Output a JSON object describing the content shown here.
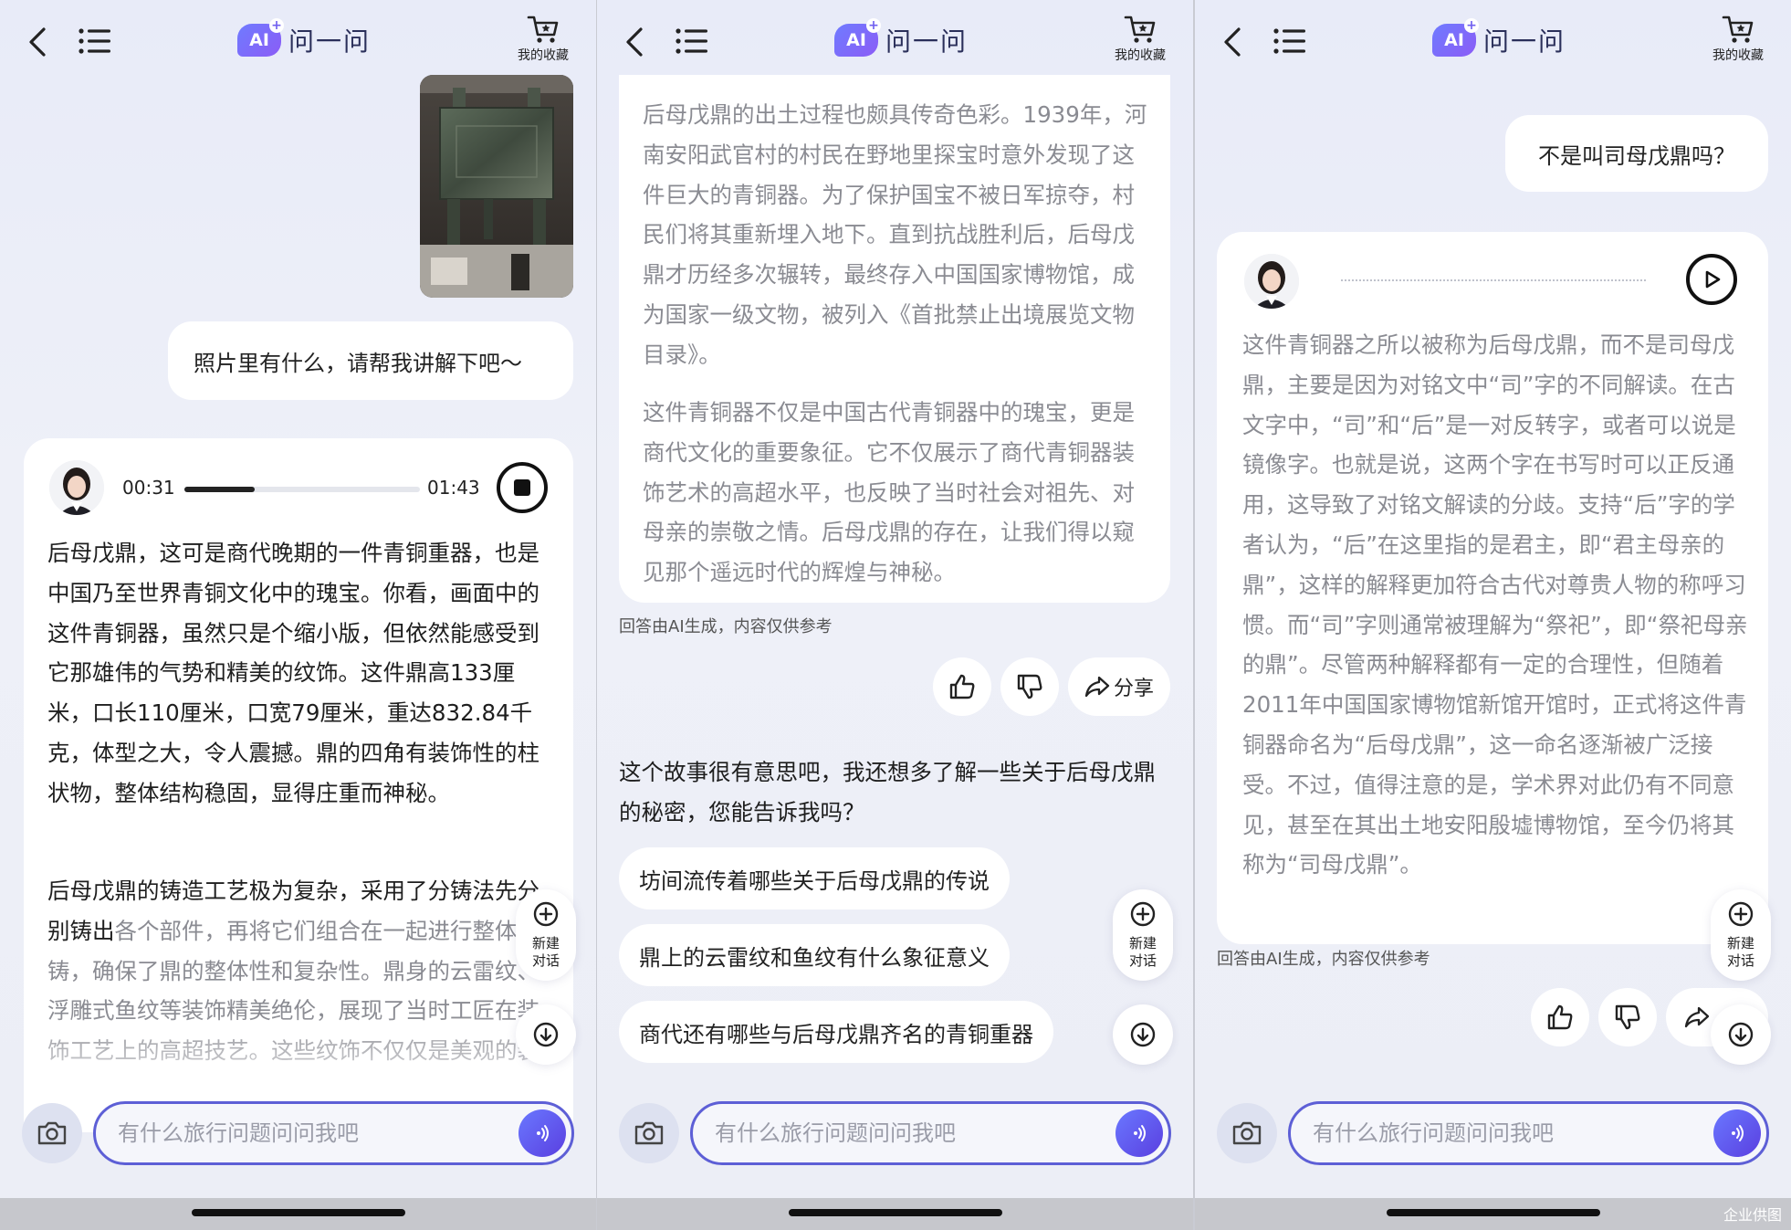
{
  "header": {
    "ai_badge": "AI",
    "title": "问一问",
    "favorites_label": "我的收藏"
  },
  "panel1": {
    "user_question": "照片里有什么，请帮我讲解下吧～",
    "audio": {
      "elapsed": "00:31",
      "total": "01:43",
      "progress": 0.3
    },
    "paragraphs": [
      "后母戊鼎，这可是商代晚期的一件青铜重器，也是中国乃至世界青铜文化中的瑰宝。你看，画面中的这件青铜器，虽然只是个缩小版，但依然能感受到它那雄伟的气势和精美的纹饰。这件鼎高133厘米，口长110厘米，口宽79厘米，重达832.84千克，体型之大，令人震撼。鼎的四角有装饰性的柱状物，整体结构稳固，显得庄重而神秘。",
      "后母戊鼎的铸造工艺极为复杂，采用了分铸法",
      "先分别铸出",
      "各个部件，再将它们组合在一起进行整体浇铸，确保了鼎的整体性和复杂性。鼎身的云雷纹、浮雕式鱼纹等装饰精美绝伦，展现了当时工匠在装饰工艺上的高超技艺。这些纹饰不仅仅是美观的装饰，还蕴含着深厚的文化意义。"
    ]
  },
  "panel2": {
    "paragraphs": [
      "后母戊鼎的出土过程也颇具传奇色彩。1939年，河南安阳武官村的村民在野地里探宝时意外发现了这件巨大的青铜器。为了保护国宝不被日军掠夺，村民们将其重新埋入地下。直到抗战胜利后，后母戊鼎才历经多次辗转，最终存入中国国家博物馆，成为国家一级文物，被列入《首批禁止出境展览文物目录》。",
      "这件青铜器不仅是中国古代青铜器中的瑰宝，更是商代文化的重要象征。它不仅展示了商代青铜器装饰艺术的高超水平，也反映了当时社会对祖先、对母亲的崇敬之情。后母戊鼎的存在，让我们得以窥见那个遥远时代的辉煌与神秘。"
    ],
    "disclaimer": "回答由AI生成，内容仅供参考",
    "share_label": "分享",
    "prompt": "这个故事很有意思吧，我还想多了解一些关于后母戊鼎的秘密，您能告诉我吗？",
    "suggestions": [
      "坊间流传着哪些关于后母戊鼎的传说",
      "鼎上的云雷纹和鱼纹有什么象征意义",
      "商代还有哪些与后母戊鼎齐名的青铜重器"
    ]
  },
  "panel3": {
    "user_question": "不是叫司母戊鼎吗？",
    "answer": "这件青铜器之所以被称为后母戊鼎，而不是司母戊鼎，主要是因为对铭文中“司”字的不同解读。在古文字中，“司”和“后”是一对反转字，或者可以说是镜像字。也就是说，这两个字在书写时可以正反通用，这导致了对铭文解读的分歧。支持“后”字的学者认为，“后”在这里指的是君主，即“君主母亲的鼎”，这样的解释更加符合古代对尊贵人物的称呼习惯。而“司”字则通常被理解为“祭祀”，即“祭祀母亲的鼎”。尽管两种解释都有一定的合理性，但随着2011年中国国家博物馆新馆开馆时，正式将这件青铜器命名为“后母戊鼎”，这一命名逐渐被广泛接受。不过，值得注意的是，学术界对此仍有不同意见，甚至在其出土地安阳殷墟博物馆，至今仍将其称为“司母戊鼎”。",
    "disclaimer": "回答由AI生成，内容仅供参考"
  },
  "side": {
    "new_chat_label": "新建对话"
  },
  "input": {
    "placeholder": "有什么旅行问题问问我吧"
  },
  "watermark": "企业供图",
  "colors": {
    "accent": "#5d5fd6",
    "panel_bg": "#eceef6",
    "card_bg": "#ffffff",
    "muted_text": "#8a8b92"
  }
}
